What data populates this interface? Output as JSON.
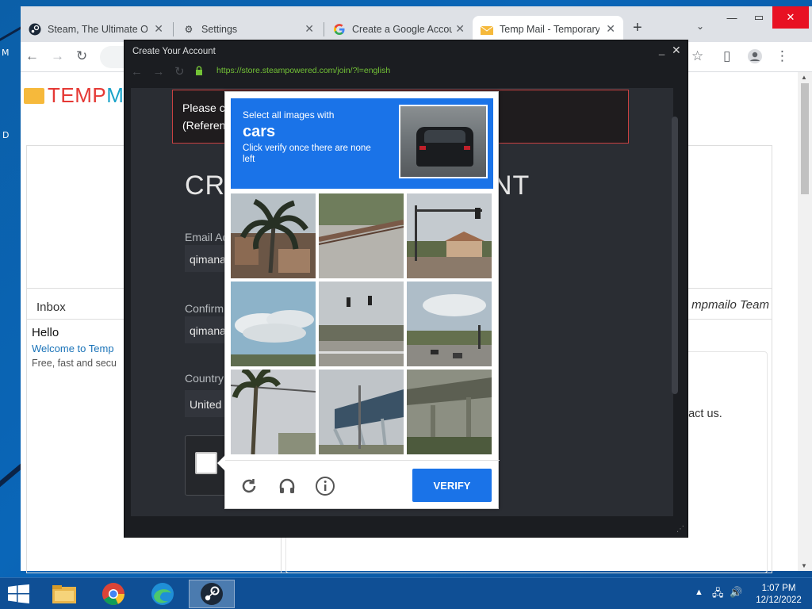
{
  "desktop": {
    "label_m": "M",
    "label_d": "D"
  },
  "browser": {
    "tabs": [
      {
        "label": "Steam, The Ultimate Onl",
        "icon": "steam-icon",
        "active": false
      },
      {
        "label": "Settings",
        "icon": "gear-icon",
        "active": false
      },
      {
        "label": "Create a Google Accoun",
        "icon": "google-icon",
        "active": false
      },
      {
        "label": "Temp Mail - Temporary",
        "icon": "tempmail-icon",
        "active": true
      }
    ],
    "new_tab": "+",
    "colors": {
      "tabstrip": "#dee1e6",
      "accent": "#1a73e8"
    }
  },
  "tempmail": {
    "logo_temp": "TEMP",
    "logo_ma": "MA",
    "inbox_label": "Inbox",
    "team_text": "mpmailo Team",
    "hello": "Hello",
    "welcome": "Welcome to Temp",
    "desc": "Free, fast and secu",
    "contact": "ntact us."
  },
  "steam": {
    "title": "Create Your Account",
    "url": "https://store.steampowered.com/join/?l=english",
    "alert_line1": "Please c",
    "alert_line2": "(Referen",
    "heading_start": "CR",
    "heading_end": "NT",
    "email_label": "Email Ad",
    "email_value": "qimana",
    "confirm_label": "Confirm",
    "confirm_value": "qimana",
    "country_label": "Country",
    "country_value": "United"
  },
  "captcha": {
    "select_text": "Select all images with",
    "target": "cars",
    "instruction": "Click verify once there are none left",
    "verify_label": "VERIFY",
    "tiles": [
      "palm-tree",
      "guardrail-road",
      "traffic-light-building",
      "sky-clouds",
      "traffic-light-overpass",
      "road-cars",
      "palm-tree-wires",
      "bridge-structure",
      "overpass"
    ],
    "colors": {
      "header": "#1a73e8",
      "button": "#1a73e8"
    }
  },
  "taskbar": {
    "time": "1:07 PM",
    "date": "12/12/2022",
    "items": [
      "file-explorer-icon",
      "chrome-icon",
      "edge-icon",
      "steam-icon"
    ]
  }
}
